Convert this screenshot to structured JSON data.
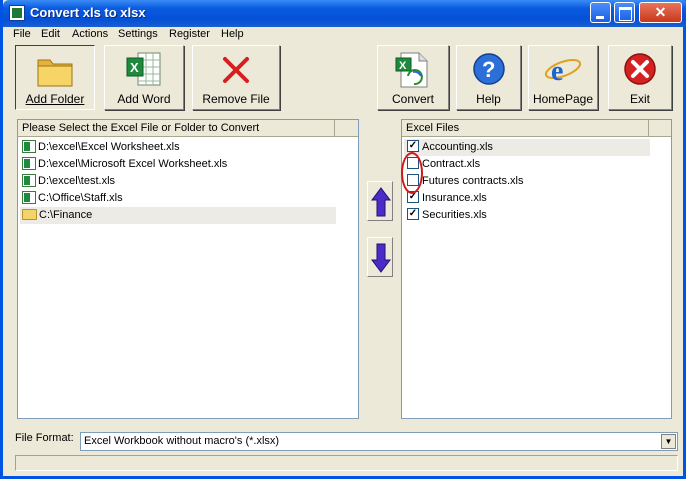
{
  "window": {
    "title": "Convert xls to xlsx"
  },
  "menu": [
    "File",
    "Edit",
    "Actions",
    "Settings",
    "Register",
    "Help"
  ],
  "toolbar": {
    "add_folder": "Add Folder",
    "add_word": "Add Word",
    "remove_file": "Remove File",
    "convert": "Convert",
    "help": "Help",
    "homepage": "HomePage",
    "exit": "Exit"
  },
  "left_panel": {
    "header": "Please Select the Excel File or Folder to Convert",
    "items": [
      {
        "icon": "excel-file-icon",
        "path": "D:\\excel\\Excel Worksheet.xls"
      },
      {
        "icon": "excel-file-icon",
        "path": "D:\\excel\\Microsoft Excel Worksheet.xls"
      },
      {
        "icon": "excel-file-icon",
        "path": "D:\\excel\\test.xls"
      },
      {
        "icon": "excel-file-icon",
        "path": "C:\\Office\\Staff.xls"
      },
      {
        "icon": "folder-icon",
        "path": "C:\\Finance"
      }
    ]
  },
  "right_panel": {
    "header": "Excel Files",
    "items": [
      {
        "name": "Accounting.xls",
        "checked": true
      },
      {
        "name": "Contract.xls",
        "checked": false
      },
      {
        "name": "Futures contracts.xls",
        "checked": false
      },
      {
        "name": "Insurance.xls",
        "checked": true
      },
      {
        "name": "Securities.xls",
        "checked": true
      }
    ]
  },
  "file_format": {
    "label": "File Format:",
    "value": "Excel Workbook without macro's (*.xlsx)"
  },
  "colors": {
    "titlebar": "#0a5ce0",
    "window_bg": "#ece9d8",
    "highlight_circle": "#d01818"
  }
}
